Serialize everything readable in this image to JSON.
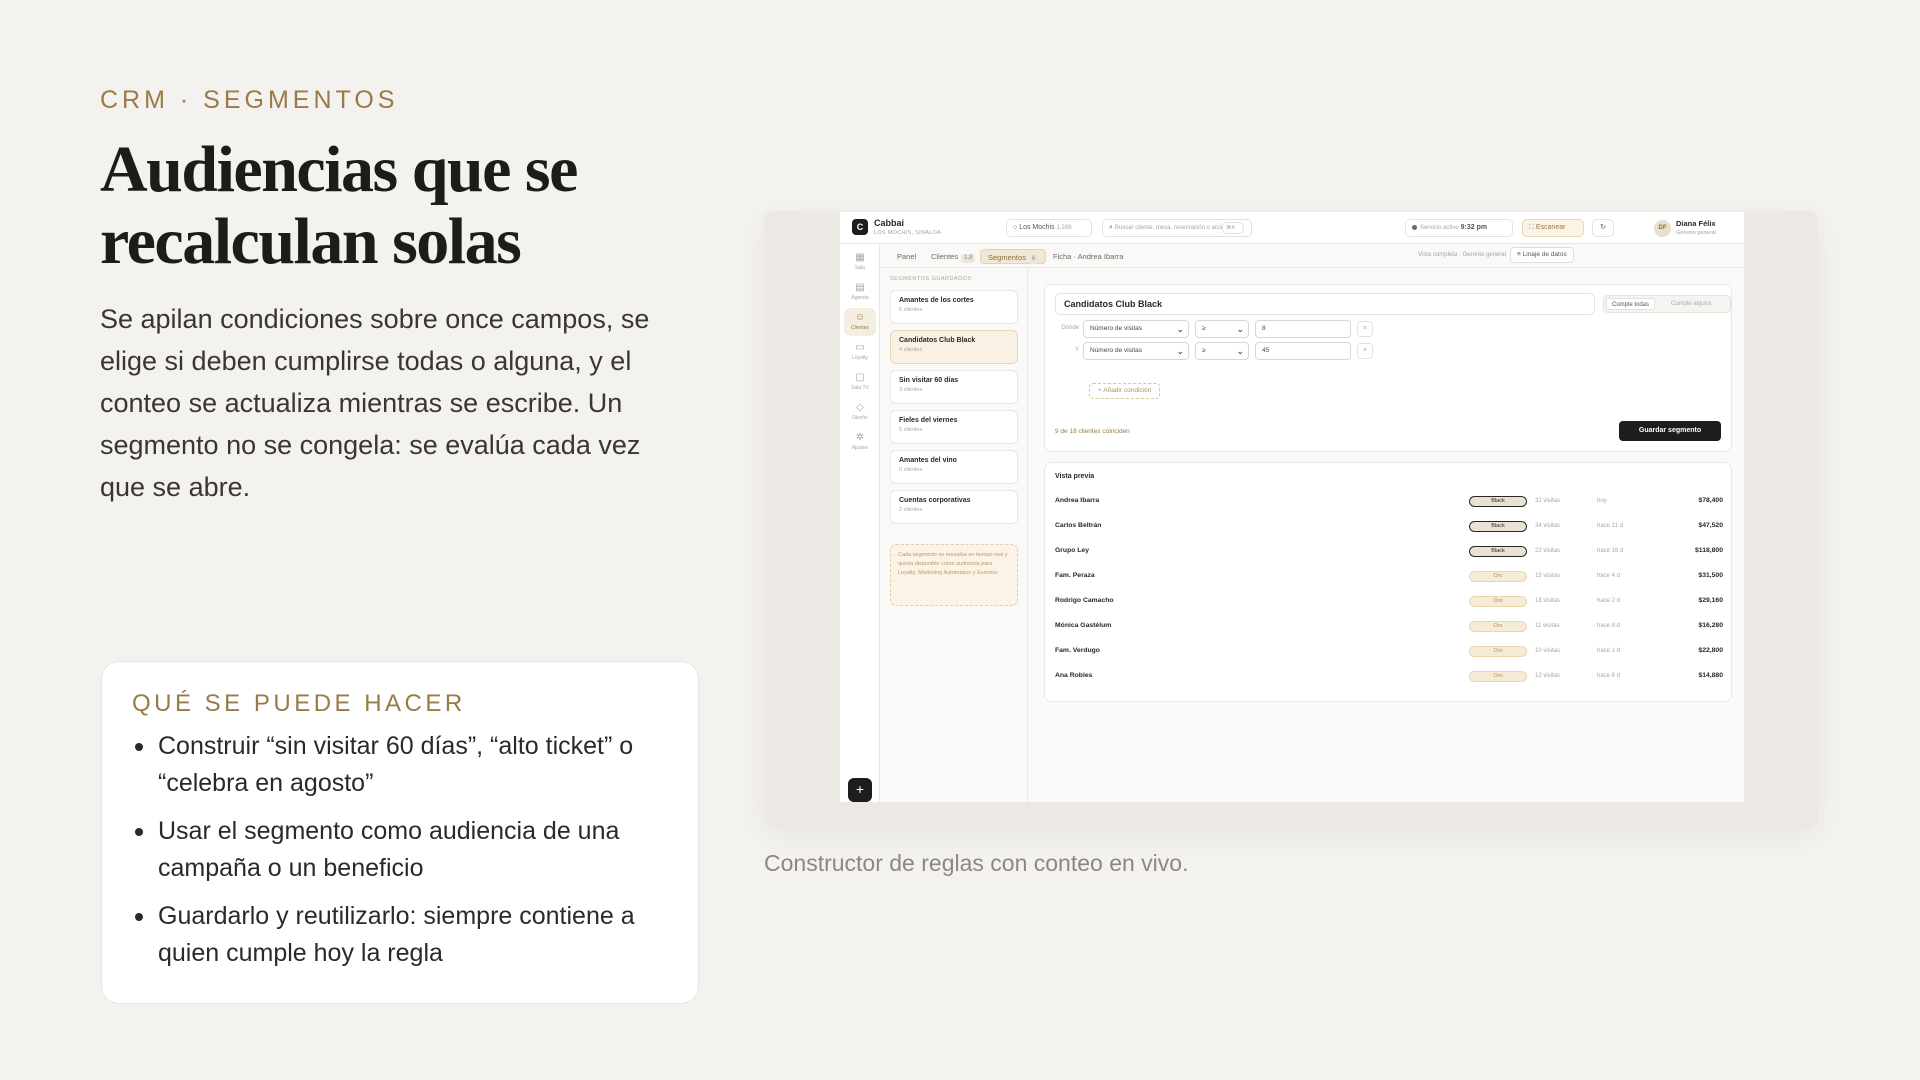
{
  "left": {
    "eyebrow": "CRM · SEGMENTOS",
    "title": "Audiencias que se recalculan solas",
    "body": "Se apilan condiciones sobre once campos, se elige si deben cumplirse todas o alguna, y el conteo se actualiza mientras se escribe. Un segmento no se congela: se evalúa cada vez que se abre.",
    "card_title": "QUÉ SE PUEDE HACER",
    "bullets": [
      "Construir “sin visitar 60 días”, “alto ticket” o “celebra en agosto”",
      "Usar el segmento como audiencia de una campaña o un beneficio",
      "Guardarlo y reutilizarlo: siempre contiene a quien cumple hoy la regla"
    ]
  },
  "caption": "Constructor de reglas con conteo en vivo.",
  "app": {
    "logo": "C",
    "brand": "Cabbai",
    "brand_sub": "LOS MOCHIS, SINALOA",
    "location": "Los Mochis",
    "location_count": "1,289",
    "search_placeholder": "Buscar cliente, mesa, reservación o acción",
    "search_shortcut": "⌘K",
    "service_label": "Servicio activo",
    "service_time": "9:32 pm",
    "scan_label": "Escanear",
    "user_initials": "DF",
    "user_name": "Diana Félix",
    "user_role": "Gerente general",
    "rail": [
      {
        "icon": "▦",
        "label": "Sala"
      },
      {
        "icon": "▤",
        "label": "Agenda"
      },
      {
        "icon": "☺",
        "label": "Clientes"
      },
      {
        "icon": "▭",
        "label": "Loyalty"
      },
      {
        "icon": "▢",
        "label": "Sala TV"
      },
      {
        "icon": "◇",
        "label": "Diseño"
      },
      {
        "icon": "✲",
        "label": "Ajustes"
      }
    ],
    "fab": "+",
    "tabs": {
      "panel": "Panel",
      "clientes": "Clientes",
      "clientes_count": "1,8",
      "segmentos": "Segmentos",
      "segmentos_count": "6",
      "ficha": "Ficha · Andrea Ibarra"
    },
    "view_label": "Vista completa · Gerente general",
    "lineage_label": "Linaje de datos",
    "saved_heading": "SEGMENTOS GUARDADOS",
    "segments": [
      {
        "name": "Amantes de los cortes",
        "count": "6 clientes"
      },
      {
        "name": "Candidatos Club Black",
        "count": "4 clientes"
      },
      {
        "name": "Sin visitar 60 días",
        "count": "3 clientes"
      },
      {
        "name": "Fieles del viernes",
        "count": "5 clientes"
      },
      {
        "name": "Amantes del vino",
        "count": "0 clientes"
      },
      {
        "name": "Cuentas corporativas",
        "count": "2 clientes"
      }
    ],
    "segment_note": "Cada segmento se reevalúa en tiempo real y queda disponible como audiencia para Loyalty, Marketing Automation y Eventos.",
    "builder": {
      "name": "Candidatos Club Black",
      "match_all": "Cumple todas",
      "match_any": "Cumple alguna",
      "conditions": [
        {
          "label": "Donde",
          "field": "Número de visitas",
          "op": "≥",
          "value": "8"
        },
        {
          "label": "Y",
          "field": "Número de visitas",
          "op": "≥",
          "value": "45"
        }
      ],
      "add_condition": "+ Añadir condición",
      "match_count": "9 de 18 clientes coinciden",
      "save": "Guardar segmento"
    },
    "preview": {
      "title": "Vista previa",
      "rows": [
        {
          "name": "Andrea Ibarra",
          "tier": "Black",
          "visits": "32 visitas",
          "last": "hoy",
          "amount": "$78,400"
        },
        {
          "name": "Carlos Beltrán",
          "tier": "Black",
          "visits": "34 visitas",
          "last": "hace 11 d",
          "amount": "$47,520"
        },
        {
          "name": "Grupo Ley",
          "tier": "Black",
          "visits": "22 visitas",
          "last": "hace 16 d",
          "amount": "$118,800"
        },
        {
          "name": "Fam. Peraza",
          "tier": "Oro",
          "visits": "15 visitas",
          "last": "hace 4 d",
          "amount": "$31,500"
        },
        {
          "name": "Rodrigo Camacho",
          "tier": "Oro",
          "visits": "18 visitas",
          "last": "hace 2 d",
          "amount": "$29,160"
        },
        {
          "name": "Mónica Gastélum",
          "tier": "Oro",
          "visits": "11 visitas",
          "last": "hace 8 d",
          "amount": "$16,280"
        },
        {
          "name": "Fam. Verdugo",
          "tier": "Oro",
          "visits": "10 visitas",
          "last": "hace 1 d",
          "amount": "$22,800"
        },
        {
          "name": "Ana Robles",
          "tier": "Oro",
          "visits": "12 visitas",
          "last": "hace 6 d",
          "amount": "$14,880"
        }
      ]
    }
  }
}
